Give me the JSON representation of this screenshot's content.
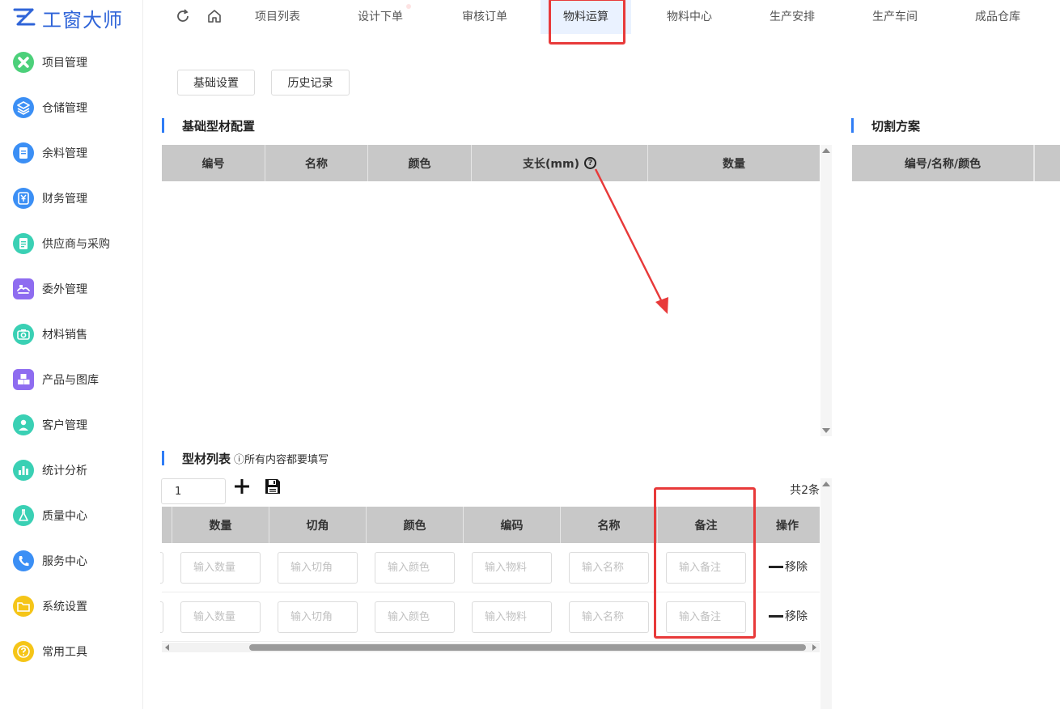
{
  "app": {
    "logo_text": "工窗大师"
  },
  "sidebar": {
    "items": [
      {
        "label": "项目管理",
        "icon": "close-circle-icon",
        "color": "#4cd07a"
      },
      {
        "label": "仓储管理",
        "icon": "stack-icon",
        "color": "#3b8ff5"
      },
      {
        "label": "余料管理",
        "icon": "document-icon",
        "color": "#3b8ff5"
      },
      {
        "label": "财务管理",
        "icon": "yen-icon",
        "color": "#3b8ff5"
      },
      {
        "label": "供应商与采购",
        "icon": "list-icon",
        "color": "#3ad0b4"
      },
      {
        "label": "委外管理",
        "icon": "handshake-icon",
        "color": "#8e6cf0"
      },
      {
        "label": "材料销售",
        "icon": "camera-icon",
        "color": "#3ad0b4"
      },
      {
        "label": "产品与图库",
        "icon": "boxes-icon",
        "color": "#8e6cf0"
      },
      {
        "label": "客户管理",
        "icon": "user-icon",
        "color": "#3ad0b4"
      },
      {
        "label": "统计分析",
        "icon": "chart-icon",
        "color": "#3ad0b4"
      },
      {
        "label": "质量中心",
        "icon": "flask-icon",
        "color": "#3ad0b4"
      },
      {
        "label": "服务中心",
        "icon": "phone-icon",
        "color": "#3b8ff5"
      },
      {
        "label": "系统设置",
        "icon": "folder-icon",
        "color": "#f5c518"
      },
      {
        "label": "常用工具",
        "icon": "question-icon",
        "color": "#f5c518"
      }
    ]
  },
  "topnav": {
    "tabs": [
      {
        "label": "项目列表"
      },
      {
        "label": "设计下单"
      },
      {
        "label": "审核订单"
      },
      {
        "label": "物料运算",
        "active": true
      },
      {
        "label": "物料中心"
      },
      {
        "label": "生产安排"
      },
      {
        "label": "生产车间"
      },
      {
        "label": "成品仓库"
      }
    ]
  },
  "toolbar": {
    "basic_settings": "基础设置",
    "history": "历史记录"
  },
  "base_config": {
    "title": "基础型材配置",
    "columns": [
      "编号",
      "名称",
      "颜色",
      "支长(mm)",
      "数量"
    ]
  },
  "cutting_plan": {
    "title": "切割方案",
    "columns": [
      "编号/名称/颜色"
    ]
  },
  "profile_list": {
    "title": "型材列表",
    "hint": "ⓘ所有内容都要填写",
    "page_value": "1",
    "total": "共2条",
    "columns": [
      "数量",
      "切角",
      "颜色",
      "编码",
      "名称",
      "备注",
      "操作"
    ],
    "placeholders": {
      "quantity": "输入数量",
      "angle": "输入切角",
      "color": "输入颜色",
      "code": "输入物料",
      "name": "输入名称",
      "remark": "输入备注"
    },
    "remove_label": "移除",
    "rows": [
      {},
      {}
    ]
  },
  "colors": {
    "accent": "#2f7df6",
    "annotation": "#e83a3a",
    "header_gray": "#c8c8c8"
  }
}
